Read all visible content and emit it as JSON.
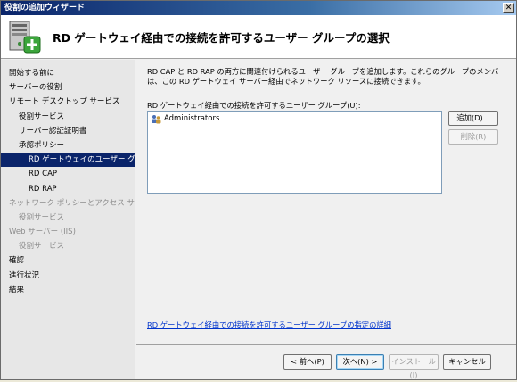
{
  "window": {
    "title": "役割の追加ウィザード",
    "close_label": "✕"
  },
  "header": {
    "title": "RD ゲートウェイ経由での接続を許可するユーザー グループの選択"
  },
  "sidebar": {
    "items": [
      {
        "label": "開始する前に",
        "level": 0,
        "state": "normal"
      },
      {
        "label": "サーバーの役割",
        "level": 0,
        "state": "normal"
      },
      {
        "label": "リモート デスクトップ サービス",
        "level": 0,
        "state": "normal"
      },
      {
        "label": "役割サービス",
        "level": 1,
        "state": "normal"
      },
      {
        "label": "サーバー認証証明書",
        "level": 1,
        "state": "normal"
      },
      {
        "label": "承認ポリシー",
        "level": 1,
        "state": "normal"
      },
      {
        "label": "RD ゲートウェイのユーザー グ...",
        "level": 2,
        "state": "selected"
      },
      {
        "label": "RD CAP",
        "level": 2,
        "state": "normal"
      },
      {
        "label": "RD RAP",
        "level": 2,
        "state": "normal"
      },
      {
        "label": "ネットワーク ポリシーとアクセス サービ...",
        "level": 0,
        "state": "disabled"
      },
      {
        "label": "役割サービス",
        "level": 1,
        "state": "disabled"
      },
      {
        "label": "Web サーバー (IIS)",
        "level": 0,
        "state": "disabled"
      },
      {
        "label": "役割サービス",
        "level": 1,
        "state": "disabled"
      },
      {
        "label": "確認",
        "level": 0,
        "state": "normal"
      },
      {
        "label": "進行状況",
        "level": 0,
        "state": "normal"
      },
      {
        "label": "結果",
        "level": 0,
        "state": "normal"
      }
    ]
  },
  "main": {
    "description": "RD CAP と RD RAP の両方に関連付けられるユーザー グループを追加します。これらのグループのメンバーは、この RD ゲートウェイ サーバー経由でネットワーク リソースに接続できます。",
    "list_label": "RD ゲートウェイ経由での接続を許可するユーザー グループ(U):",
    "groups": [
      "Administrators"
    ],
    "add_button": "追加(D)...",
    "remove_button": "削除(R)",
    "help_link": "RD ゲートウェイ経由での接続を許可するユーザー グループの指定の詳細"
  },
  "footer": {
    "back": "< 前へ(P)",
    "next": "次へ(N) >",
    "install": "インストール(I)",
    "cancel": "キャンセル"
  },
  "colors": {
    "selection": "#0a246a",
    "link": "#0033cc",
    "title_bar_start": "#0a246a"
  }
}
